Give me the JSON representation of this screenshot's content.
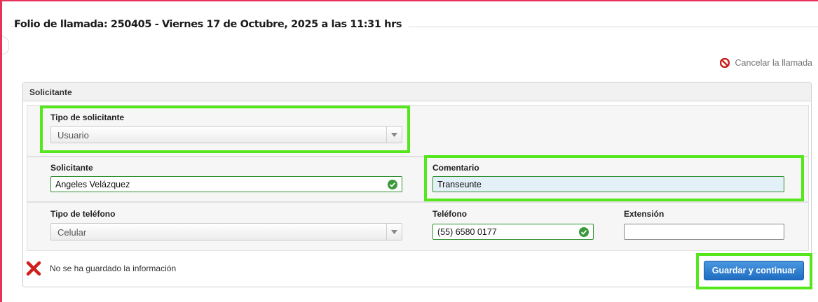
{
  "header": {
    "title": "Folio de llamada: 250405 - Viernes 17 de Octubre, 2025 a las 11:31 hrs",
    "cancel_label": "Cancelar la llamada",
    "cancel_icon": "cancel-circle-icon"
  },
  "panel": {
    "title": "Solicitante",
    "tipo_solicitante": {
      "label": "Tipo de solicitante",
      "value": "Usuario"
    },
    "solicitante": {
      "label": "Solicitante",
      "value": "Angeles Velázquez"
    },
    "comentario": {
      "label": "Comentario",
      "value": "Transeunte"
    },
    "tipo_telefono": {
      "label": "Tipo de teléfono",
      "value": "Celular"
    },
    "telefono": {
      "label": "Teléfono",
      "value": "(55) 6580 0177"
    },
    "extension": {
      "label": "Extensión",
      "value": ""
    }
  },
  "footer": {
    "status_text": "No se ha guardado la información",
    "status_icon": "error-x-icon",
    "save_label": "Guardar y continuar"
  },
  "colors": {
    "accent_frame": "#e8325a",
    "highlight": "#55e61c",
    "button": "#1f6dc2",
    "valid": "#2f8f2f",
    "error": "#d0201a"
  }
}
